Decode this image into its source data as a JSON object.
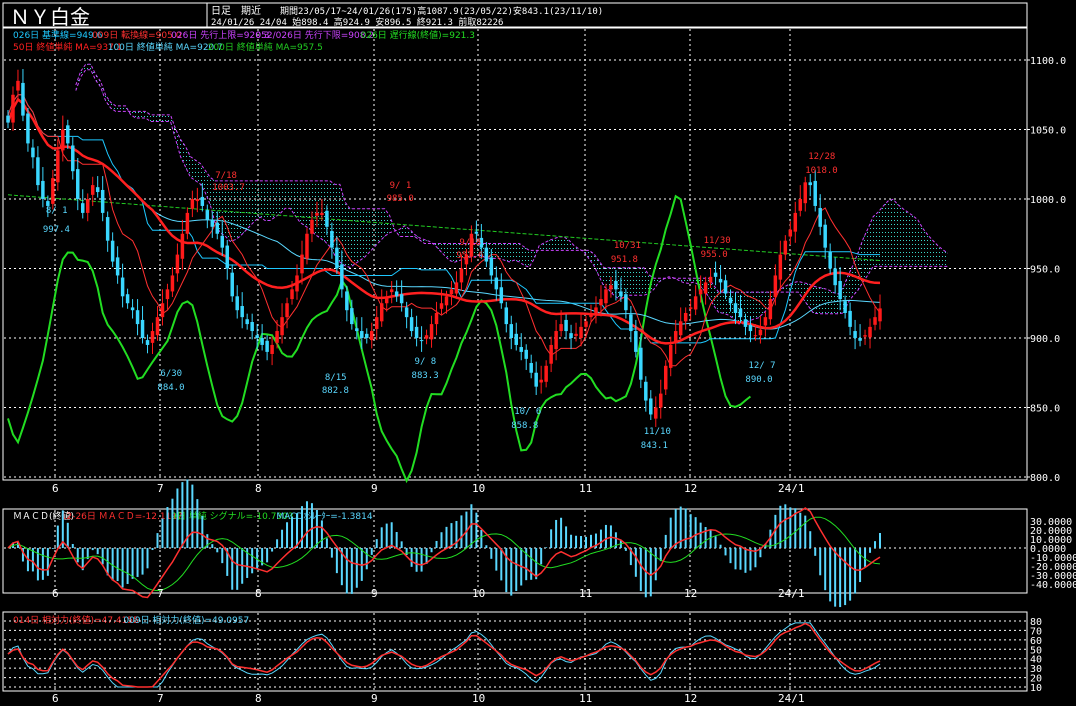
{
  "header": {
    "title": "ＮＹ白金",
    "period_label": "日足　期近",
    "range_info": "期間23/05/17~24/01/26(175)高1087.9(23/05/22)安843.1(23/11/10)",
    "ohlc_info": "24/01/26 24/04 始898.4 高924.9 安896.5 終921.3 前取82226"
  },
  "legends": {
    "row1": [
      {
        "text": "026日 基準線=949.6",
        "color": "#1ec8ff"
      },
      {
        "text": "009日 転換線=905.0",
        "color": "#ff3030"
      },
      {
        "text": "026日 先行上限=920.3",
        "color": "#cc44ff"
      },
      {
        "text": "052/026日 先行下限=908.2",
        "color": "#cc44ff"
      },
      {
        "text": "026日 遅行線(終値)=921.3",
        "color": "#22dd22"
      }
    ],
    "row2": [
      {
        "text": "50日 終値単純 MA=937.1",
        "color": "#ff2020"
      },
      {
        "text": "100日 終値単純 MA=920.7",
        "color": "#5ad8ff"
      },
      {
        "text": "200日 終値単純 MA=957.5",
        "color": "#22cc22"
      }
    ],
    "macd": [
      {
        "text": "ＭＡＣＤ(終値)",
        "color": "#ffffff"
      },
      {
        "text": "12-26日 ＭＡＣＤ=-12.1117",
        "color": "#ff3030"
      },
      {
        "text": "9日 単純 シグナル=-10.7303",
        "color": "#22dd22"
      },
      {
        "text": "MACDｵｼﾚｰﾀｰ=-1.3814",
        "color": "#5ad8ff"
      }
    ],
    "rsi": [
      {
        "text": "014日 相対力(終値)=47.4155",
        "color": "#ff3030"
      },
      {
        "text": "009日 相対力(終値)=49.0957",
        "color": "#5ad8ff"
      }
    ]
  },
  "colors": {
    "up": "#ff1a1a",
    "down": "#3ad7ff",
    "grid": "#ffffff",
    "bg": "#000000"
  },
  "chart_data": [
    {
      "type": "candlestick",
      "title": "ＮＹ白金",
      "ylim": [
        800,
        1100
      ],
      "yticks": [
        "1100.0",
        "1050.0",
        "1000.0",
        "950.0",
        "900.0",
        "850.0",
        "800.0"
      ],
      "xticks": [
        "6",
        "7",
        "8",
        "9",
        "10",
        "11",
        "12",
        "24/1"
      ],
      "closes": [
        1055,
        1075,
        1085,
        1060,
        1040,
        1030,
        1010,
        1000,
        995,
        1015,
        1035,
        1050,
        1040,
        1020,
        1000,
        990,
        1000,
        1010,
        1005,
        990,
        970,
        955,
        945,
        930,
        925,
        920,
        910,
        900,
        895,
        905,
        915,
        925,
        935,
        945,
        960,
        975,
        990,
        1000,
        1000,
        995,
        985,
        980,
        975,
        965,
        950,
        930,
        920,
        915,
        910,
        905,
        900,
        895,
        890,
        895,
        905,
        915,
        925,
        935,
        945,
        960,
        975,
        985,
        990,
        990,
        980,
        965,
        950,
        935,
        920,
        910,
        905,
        900,
        900,
        905,
        915,
        925,
        930,
        935,
        930,
        925,
        915,
        905,
        900,
        898,
        902,
        910,
        918,
        925,
        930,
        935,
        940,
        950,
        960,
        975,
        975,
        965,
        955,
        945,
        935,
        925,
        910,
        900,
        895,
        890,
        885,
        875,
        865,
        870,
        880,
        895,
        905,
        910,
        905,
        900,
        903,
        908,
        912,
        918,
        922,
        928,
        935,
        938,
        935,
        930,
        920,
        905,
        890,
        870,
        855,
        845,
        850,
        860,
        880,
        895,
        905,
        912,
        918,
        922,
        930,
        935,
        940,
        944,
        944,
        940,
        932,
        925,
        918,
        915,
        908,
        905,
        902,
        906,
        915,
        928,
        945,
        960,
        970,
        978,
        990,
        1000,
        1012,
        1010,
        995,
        980,
        965,
        950,
        938,
        928,
        918,
        908,
        900,
        898,
        902,
        908,
        915,
        921.3
      ],
      "annotations": [
        {
          "label": "8/ 1",
          "value": "997.4"
        },
        {
          "label": "6/30",
          "value": "884.0"
        },
        {
          "label": "7/18",
          "value": "1003.7"
        },
        {
          "label": "8/15",
          "value": "882.8"
        },
        {
          "label": "9/ 1",
          "value": "985.0"
        },
        {
          "label": "9/ 8",
          "value": "883.3"
        },
        {
          "label": "9/18",
          "value": "957.6"
        },
        {
          "label": "10/ 6",
          "value": "858.8"
        },
        {
          "label": "10/31",
          "value": "951.8"
        },
        {
          "label": "11/10",
          "value": "843.1"
        },
        {
          "label": "11/30",
          "value": "955.0"
        },
        {
          "label": "12/ 7",
          "value": "890.0"
        },
        {
          "label": "12/28",
          "value": "1018.0"
        }
      ],
      "lines": {
        "ma50_end": 937.1,
        "ma100_end": 920.7,
        "ma200_end": 957.5,
        "kijun_end": 949.6,
        "tenkan_end": 905.0,
        "senkou_a_end": 920.3,
        "senkou_b_end": 908.2,
        "chikou_end": 921.3
      }
    },
    {
      "type": "line",
      "title": "ＭＡＣＤ(終値)",
      "ylim": [
        -40,
        30
      ],
      "yticks": [
        "30.0000",
        "20.0000",
        "10.0000",
        "0.0000",
        "-10.0000",
        "-20.0000",
        "-30.0000",
        "-40.0000"
      ],
      "series": [
        {
          "name": "ＭＡＣＤ",
          "last": -12.1117
        },
        {
          "name": "シグナル",
          "last": -10.7303
        },
        {
          "name": "MACDｵｼﾚｰﾀｰ",
          "last": -1.3814
        }
      ]
    },
    {
      "type": "line",
      "title": "相対力",
      "ylim": [
        0,
        80
      ],
      "yticks": [
        "80",
        "70",
        "60",
        "50",
        "40",
        "30",
        "20",
        "10"
      ],
      "series": [
        {
          "name": "014日 相対力",
          "last": 47.4155
        },
        {
          "name": "009日 相対力",
          "last": 49.0957
        }
      ]
    }
  ]
}
